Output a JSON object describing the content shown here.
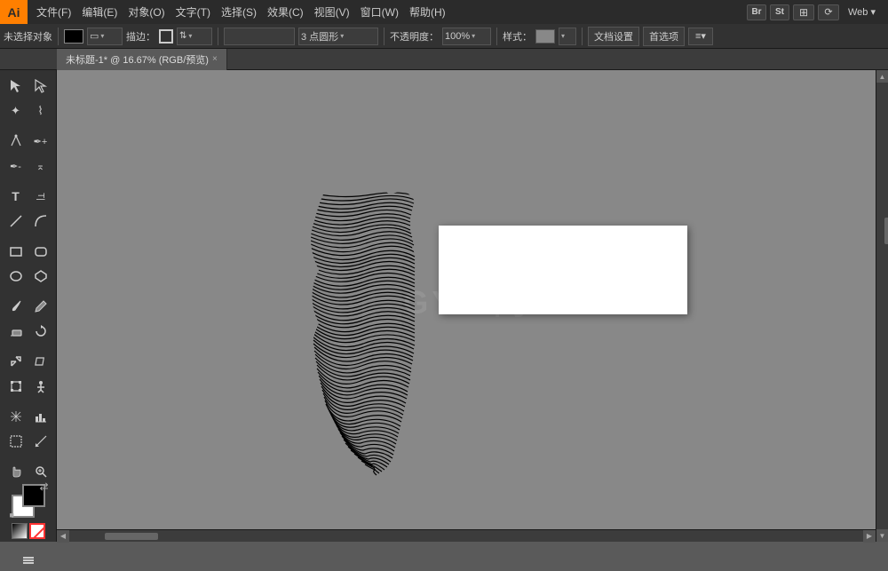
{
  "app": {
    "logo": "Ai",
    "title": "未标题-1* @ 16.67% (RGB/预览)"
  },
  "menu": {
    "items": [
      "文件(F)",
      "编辑(E)",
      "对象(O)",
      "文字(T)",
      "选择(S)",
      "效果(C)",
      "视图(V)",
      "窗口(W)",
      "帮助(H)"
    ]
  },
  "titleRight": {
    "bridge": "Br",
    "stock": "St",
    "web": "Web ▾"
  },
  "controlBar": {
    "noSelection": "未选择对象",
    "stroke": "描边：",
    "pointShape": "3 点圆形",
    "opacity": "不透明度：",
    "opacityValue": "100%",
    "style": "样式：",
    "docSettings": "文档设置",
    "preferences": "首选项"
  },
  "tab": {
    "label": "未标题-1* @ 16.67% (RGB/预览)",
    "close": "×"
  },
  "tools": {
    "rows": [
      [
        "select",
        "directSelect"
      ],
      [
        "magicWand",
        "lasso"
      ],
      [
        "pen",
        "addAnchor"
      ],
      [
        "deleteAnchor",
        "convertAnchor"
      ],
      [
        "type",
        "verticalType"
      ],
      [
        "lineSeg",
        "arc"
      ],
      [
        "rect",
        "roundRect"
      ],
      [
        "ellipse",
        "polygon"
      ],
      [
        "paintbrush",
        "pencil"
      ],
      [
        "eraser",
        "rotate"
      ],
      [
        "scale",
        "shear"
      ],
      [
        "freeTransform",
        "puppet"
      ],
      [
        "gradientMesh",
        "chartBar"
      ],
      [
        "artboard",
        "slice"
      ],
      [
        "hand",
        "zoom"
      ]
    ]
  },
  "colors": {
    "foreground": "#000000",
    "background": "#ffffff"
  },
  "canvas": {
    "background": "#888888",
    "artboardBg": "#ffffff",
    "watermark": "GY / 网"
  }
}
